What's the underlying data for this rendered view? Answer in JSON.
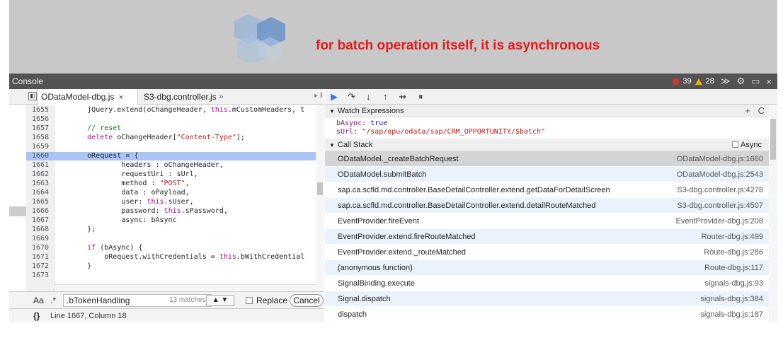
{
  "banner": {
    "text": "for batch operation itself, it is asynchronous"
  },
  "console_bar": {
    "title": "Console",
    "errors": "39",
    "warnings": "28"
  },
  "tabs": [
    {
      "label": "ODataModel-dbg.js",
      "close": "×"
    },
    {
      "label": "S3-dbg.controller.js"
    },
    {
      "label": "»"
    }
  ],
  "code": [
    {
      "n": "1655",
      "text": "        jQuery.extend(oChangeHeader, this.mCustomHeaders, t"
    },
    {
      "n": "1656",
      "text": ""
    },
    {
      "n": "1657",
      "text": "        // reset"
    },
    {
      "n": "1658",
      "text": "        delete oChangeHeader[\"Content-Type\"];"
    },
    {
      "n": "1659",
      "text": ""
    },
    {
      "n": "1660",
      "text": "        oRequest = {"
    },
    {
      "n": "1661",
      "text": "                headers : oChangeHeader,"
    },
    {
      "n": "1662",
      "text": "                requestUri : sUrl,"
    },
    {
      "n": "1663",
      "text": "                method : \"POST\","
    },
    {
      "n": "1664",
      "text": "                data : oPayload,"
    },
    {
      "n": "1665",
      "text": "                user: this.sUser,"
    },
    {
      "n": "1666",
      "text": "                password: this.sPassword,"
    },
    {
      "n": "1667",
      "text": "                async: bAsync"
    },
    {
      "n": "1668",
      "text": "        };"
    },
    {
      "n": "1669",
      "text": ""
    },
    {
      "n": "1670",
      "text": "        if (bAsync) {"
    },
    {
      "n": "1671",
      "text": "            oRequest.withCredentials = this.bWithCredential"
    },
    {
      "n": "1672",
      "text": "        }"
    },
    {
      "n": "1673",
      "text": ""
    }
  ],
  "search": {
    "aa": "Aa",
    "regex": ".*",
    "query": ".bTokenHandling",
    "matches": "13 matches",
    "replace_label": "Replace",
    "cancel_label": "Cancel"
  },
  "status": {
    "braces": "{}",
    "position": "Line 1667, Column 18"
  },
  "watch": {
    "title": "Watch Expressions",
    "add": "+",
    "refresh": "C",
    "items": [
      {
        "name": "bAsync",
        "value": "true"
      },
      {
        "name": "sUrl",
        "value": "\"/sap/opu/odata/sap/CRM_OPPORTUNITY/$batch\""
      }
    ]
  },
  "call_stack": {
    "title": "Call Stack",
    "async_label": "Async",
    "frames": [
      {
        "fn": "ODataModel._createBatchRequest",
        "loc": "ODataModel-dbg.js:1660"
      },
      {
        "fn": "ODataModel.submitBatch",
        "loc": "ODataModel-dbg.js:2543"
      },
      {
        "fn": "sap.ca.scfld.md.controller.BaseDetailController.extend.getDataForDetailScreen",
        "loc": "S3-dbg.controller.js:4278"
      },
      {
        "fn": "sap.ca.scfld.md.controller.BaseDetailController.extend.detailRouteMatched",
        "loc": "S3-dbg.controller.js:4507"
      },
      {
        "fn": "EventProvider.fireEvent",
        "loc": "EventProvider-dbg.js:208"
      },
      {
        "fn": "EventProvider.extend.fireRouteMatched",
        "loc": "Router-dbg.js:499"
      },
      {
        "fn": "EventProvider.extend._routeMatched",
        "loc": "Route-dbg.js:286"
      },
      {
        "fn": "(anonymous function)",
        "loc": "Route-dbg.js:117"
      },
      {
        "fn": "SignalBinding.execute",
        "loc": "signals-dbg.js:93"
      },
      {
        "fn": "Signal.dispatch",
        "loc": "signals-dbg.js:384"
      },
      {
        "fn": "dispatch",
        "loc": "signals-dbg.js:187"
      }
    ]
  }
}
